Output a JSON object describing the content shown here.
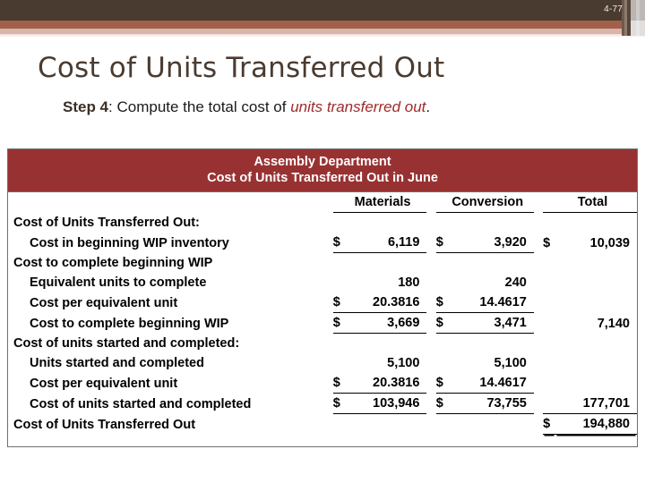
{
  "slide": {
    "page_number": "4-77",
    "title": "Cost of Units Transferred Out",
    "subtitle_step": "Step 4",
    "subtitle_mid": ": Compute the total cost of ",
    "subtitle_emph": "units transferred out",
    "subtitle_end": "."
  },
  "colors": {
    "banner_dark": "#4a3b30",
    "banner_mid": "#a2604a",
    "banner_light": "#d7b5aa",
    "table_header_red": "#983232",
    "title_text": "#4a3b30",
    "emphasis_red": "#9e2a2b"
  },
  "table": {
    "header_line1": "Assembly Department",
    "header_line2": "Cost of Units Transferred Out in June",
    "columns": [
      "Materials",
      "Conversion",
      "Total"
    ],
    "currency_symbol": "$",
    "rows": [
      {
        "label": "Cost of Units Transferred Out:",
        "materials": "",
        "conversion": "",
        "total": ""
      },
      {
        "label": "Cost in beginning WIP inventory",
        "materials": "6,119",
        "conversion": "3,920",
        "total": "10,039"
      },
      {
        "label": "Cost to complete beginning WIP",
        "materials": "",
        "conversion": "",
        "total": ""
      },
      {
        "label": "Equivalent units to complete",
        "materials": "180",
        "conversion": "240",
        "total": ""
      },
      {
        "label": "Cost per equivalent unit",
        "materials": "20.3816",
        "conversion": "14.4617",
        "total": ""
      },
      {
        "label": "Cost to complete beginning WIP",
        "materials": "3,669",
        "conversion": "3,471",
        "total": "7,140"
      },
      {
        "label": "Cost of units started and completed:",
        "materials": "",
        "conversion": "",
        "total": ""
      },
      {
        "label": "Units started and completed",
        "materials": "5,100",
        "conversion": "5,100",
        "total": ""
      },
      {
        "label": "Cost per equivalent unit",
        "materials": "20.3816",
        "conversion": "14.4617",
        "total": ""
      },
      {
        "label": "Cost of units started and completed",
        "materials": "103,946",
        "conversion": "73,755",
        "total": "177,701"
      },
      {
        "label": "Cost of Units Transferred Out",
        "materials": "",
        "conversion": "",
        "total": "194,880"
      }
    ]
  }
}
